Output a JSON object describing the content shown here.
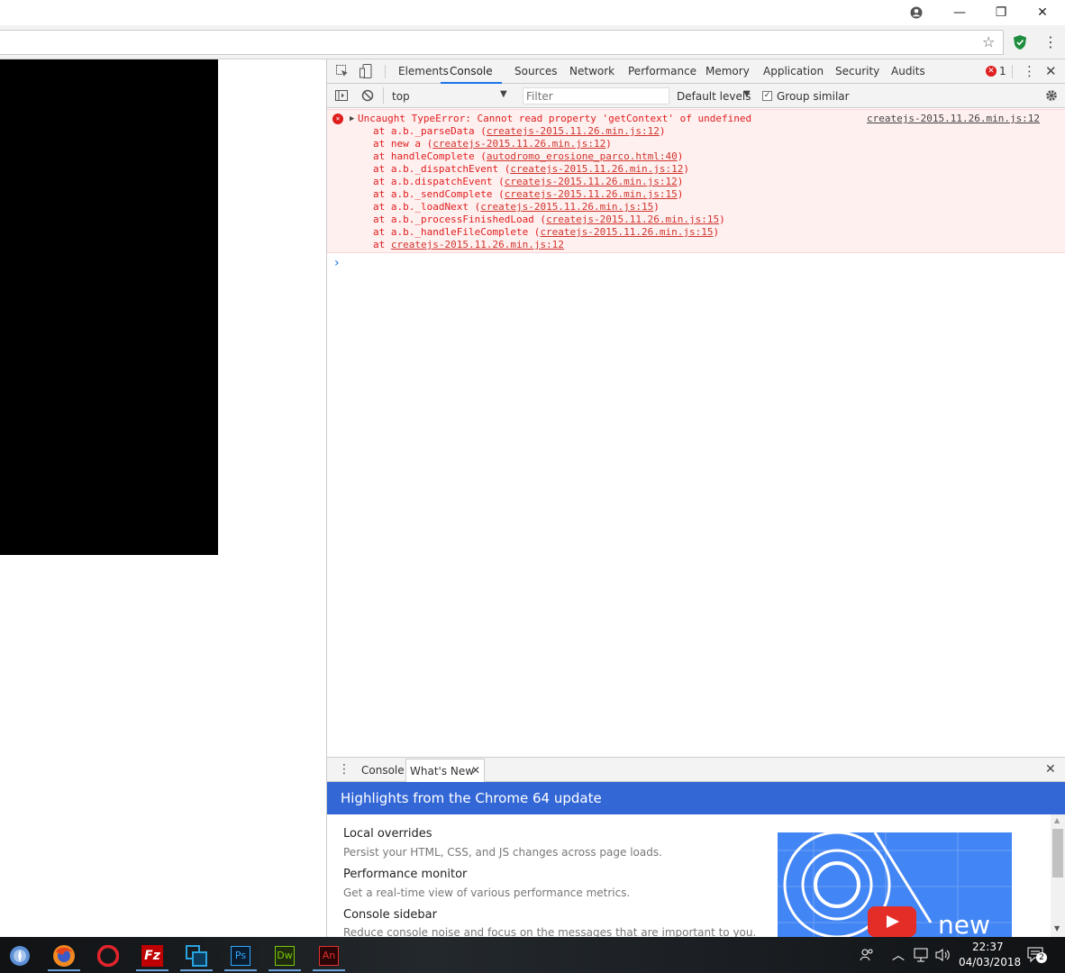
{
  "window": {
    "account_icon": "account-circle-icon",
    "minimize": "—",
    "restore": "❐",
    "close": "✕"
  },
  "addressbar": {
    "star_icon": "☆",
    "menu_icon": "⋮"
  },
  "devtools": {
    "tabs": [
      "Elements",
      "Console",
      "Sources",
      "Network",
      "Performance",
      "Memory",
      "Application",
      "Security",
      "Audits"
    ],
    "active_tab": "Console",
    "error_count": "1",
    "context": "top",
    "filter_placeholder": "Filter",
    "levels": "Default levels",
    "group_similar": "Group similar",
    "error": {
      "message": "Uncaught TypeError: Cannot read property 'getContext' of undefined",
      "source": "createjs-2015.11.26.min.js:12",
      "stack": [
        {
          "prefix": "at a.b._parseData (",
          "link": "createjs-2015.11.26.min.js:12",
          "suffix": ")"
        },
        {
          "prefix": "at new a (",
          "link": "createjs-2015.11.26.min.js:12",
          "suffix": ")"
        },
        {
          "prefix": "at handleComplete (",
          "link": "autodromo_erosione_parco.html:40",
          "suffix": ")"
        },
        {
          "prefix": "at a.b._dispatchEvent (",
          "link": "createjs-2015.11.26.min.js:12",
          "suffix": ")"
        },
        {
          "prefix": "at a.b.dispatchEvent (",
          "link": "createjs-2015.11.26.min.js:12",
          "suffix": ")"
        },
        {
          "prefix": "at a.b._sendComplete (",
          "link": "createjs-2015.11.26.min.js:15",
          "suffix": ")"
        },
        {
          "prefix": "at a.b._loadNext (",
          "link": "createjs-2015.11.26.min.js:15",
          "suffix": ")"
        },
        {
          "prefix": "at a.b._processFinishedLoad (",
          "link": "createjs-2015.11.26.min.js:15",
          "suffix": ")"
        },
        {
          "prefix": "at a.b._handleFileComplete (",
          "link": "createjs-2015.11.26.min.js:15",
          "suffix": ")"
        },
        {
          "prefix": "at ",
          "link": "createjs-2015.11.26.min.js:12",
          "suffix": ""
        }
      ]
    },
    "prompt": "›",
    "drawer": {
      "tabs": [
        "Console",
        "What's New"
      ],
      "banner": "Highlights from the Chrome 64 update",
      "items": [
        {
          "title": "Local overrides",
          "desc": "Persist your HTML, CSS, and JS changes across page loads."
        },
        {
          "title": "Performance monitor",
          "desc": "Get a real-time view of various performance metrics."
        },
        {
          "title": "Console sidebar",
          "desc": "Reduce console noise and focus on the messages that are important to you."
        }
      ],
      "video_word": "new"
    }
  },
  "taskbar": {
    "apps": [
      {
        "name": "finder",
        "label": ""
      },
      {
        "name": "firefox",
        "label": ""
      },
      {
        "name": "opera",
        "label": "O"
      },
      {
        "name": "filezilla",
        "label": "Fz"
      },
      {
        "name": "app-blue",
        "label": ""
      },
      {
        "name": "photoshop",
        "label": "Ps"
      },
      {
        "name": "dreamweaver",
        "label": "Dw"
      },
      {
        "name": "animate",
        "label": "An"
      }
    ],
    "time": "22:37",
    "date": "04/03/2018",
    "notifications": "2"
  },
  "colors": {
    "error_red": "#e01c1c",
    "error_bg": "#fff0f0",
    "banner_blue": "#3367d6",
    "active_tab": "#1a73e8"
  }
}
